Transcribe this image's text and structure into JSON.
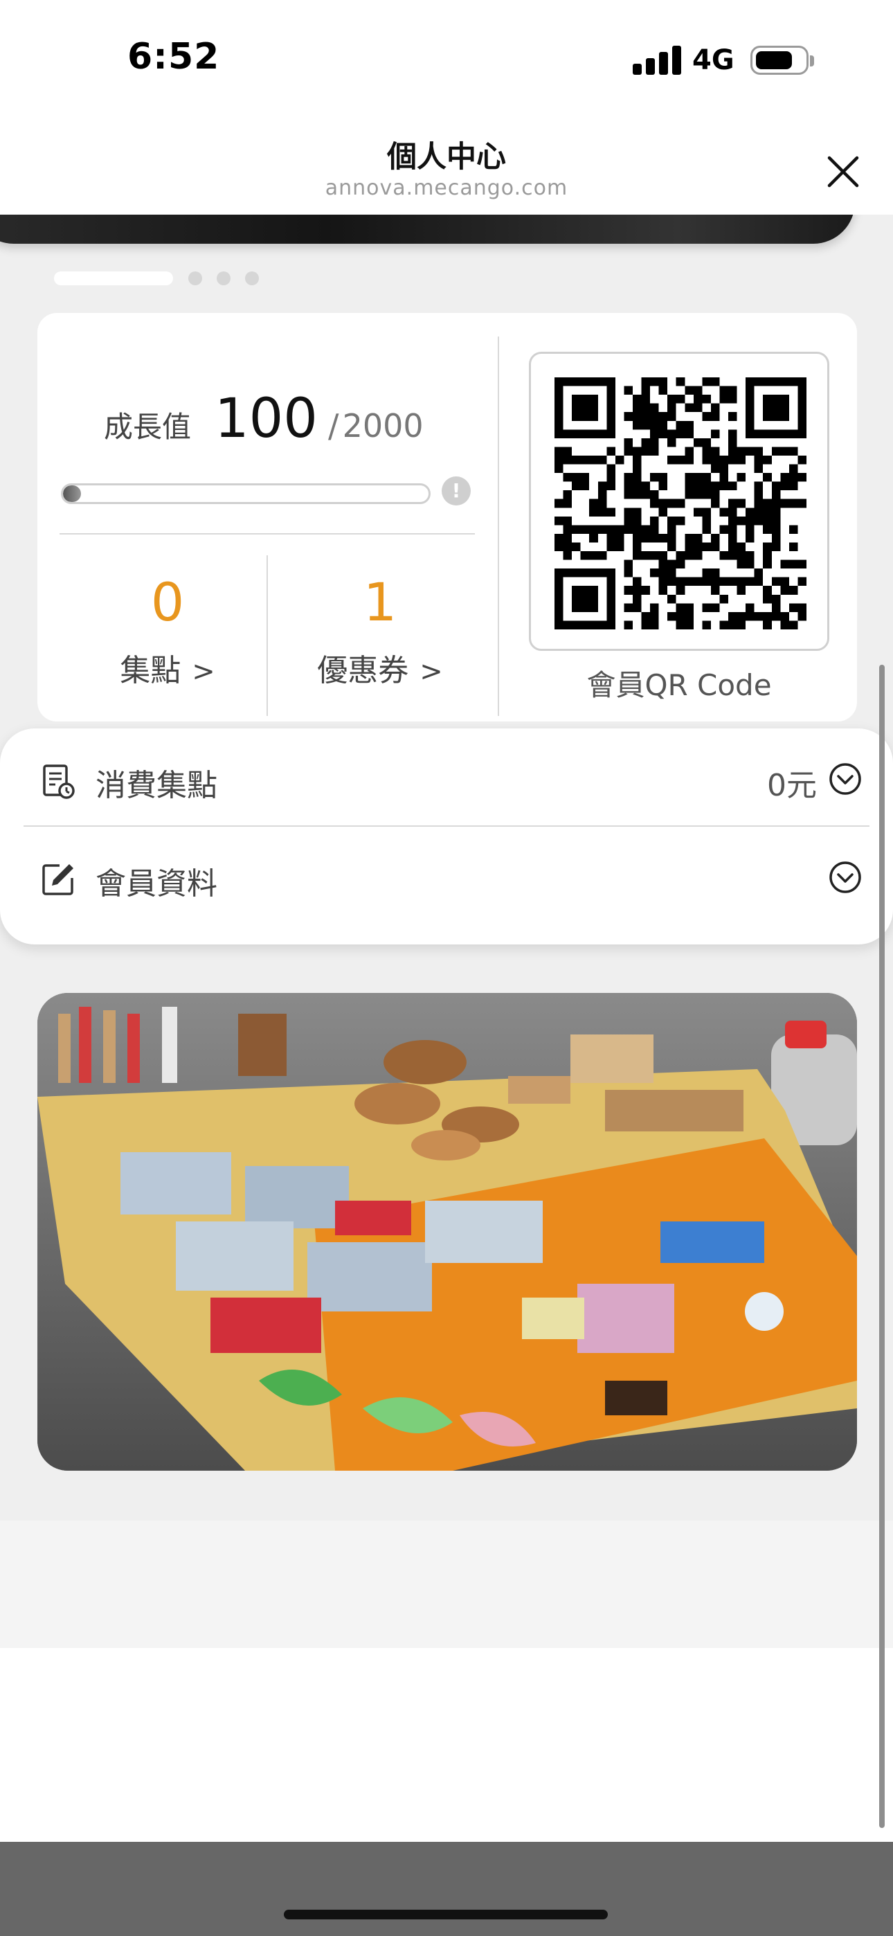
{
  "status_bar": {
    "time": "6:52",
    "network": "4G",
    "battery_icon": "battery-icon",
    "signal_icon": "signal-icon"
  },
  "header": {
    "title": "個人中心",
    "url": "annova.mecango.com",
    "close_icon": "close-icon"
  },
  "carousel": {
    "dot_count": 4,
    "active_index": 0
  },
  "growth": {
    "label": "成長值",
    "value": "100",
    "separator": "/",
    "max": "2000",
    "progress_fraction": 0.05
  },
  "stats": [
    {
      "value": "0",
      "label": "集點"
    },
    {
      "value": "1",
      "label": "優惠券"
    }
  ],
  "qr": {
    "caption": "會員QR Code"
  },
  "menu": [
    {
      "label": "消費集點",
      "value": "0元",
      "icon": "receipt-icon"
    },
    {
      "label": "會員資料",
      "value": "",
      "icon": "edit-icon"
    }
  ],
  "colors": {
    "accent": "#e8961e",
    "background": "#efefef",
    "bottom_bar": "#676767"
  }
}
